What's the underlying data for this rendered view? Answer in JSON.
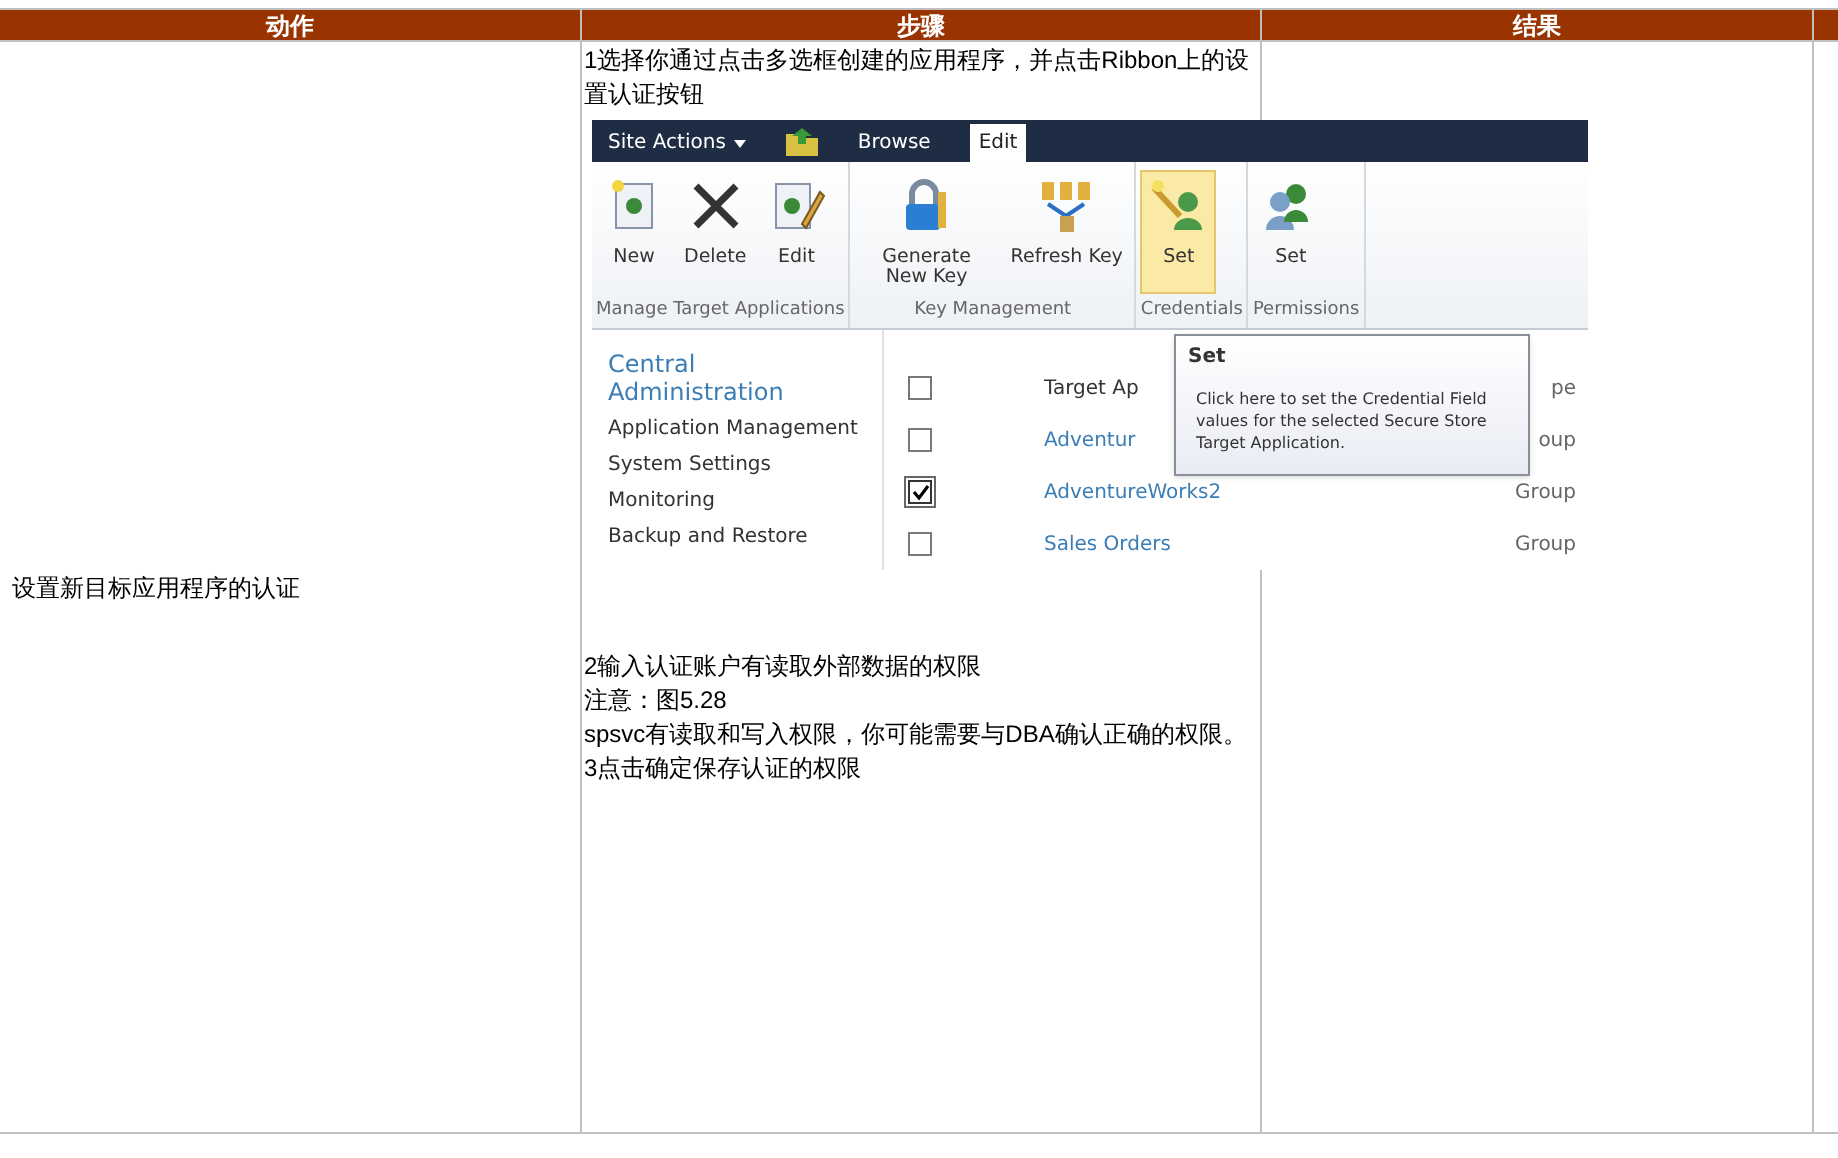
{
  "table": {
    "columns": [
      "动作",
      "步骤",
      "结果"
    ],
    "rows": [
      {
        "action": "设置新目标应用程序的认证",
        "steps_before": [
          "1选择你通过点击多选框创建的应用程序，并点击Ribbon上的设置认证按钮"
        ],
        "screenshot": {
          "tabs": [
            {
              "label": "Site Actions",
              "kind": "menu",
              "selected": false
            },
            {
              "label": "Browse",
              "kind": "tab",
              "selected": false
            },
            {
              "label": "Edit",
              "kind": "tab",
              "selected": true
            }
          ],
          "groups": [
            {
              "label": "Manage Target Applications",
              "buttons": [
                {
                  "label": "New",
                  "kind": "new",
                  "highlighted": false
                },
                {
                  "label": "Delete",
                  "kind": "delete",
                  "highlighted": false
                },
                {
                  "label": "Edit",
                  "kind": "edit",
                  "highlighted": false
                }
              ]
            },
            {
              "label": "Key Management",
              "buttons": [
                {
                  "label": "Generate New Key",
                  "kind": "lock",
                  "highlighted": false
                },
                {
                  "label": "Refresh Key",
                  "kind": "refresh",
                  "highlighted": false
                }
              ]
            },
            {
              "label": "Credentials",
              "buttons": [
                {
                  "label": "Set",
                  "kind": "key",
                  "highlighted": true
                }
              ]
            },
            {
              "label": "Permissions",
              "buttons": [
                {
                  "label": "Set",
                  "kind": "people",
                  "highlighted": false
                }
              ]
            }
          ],
          "nav": [
            {
              "label": "Central Administration",
              "kind": "heading"
            },
            {
              "label": "Application Management",
              "kind": "link"
            },
            {
              "label": "System Settings",
              "kind": "link"
            },
            {
              "label": "Monitoring",
              "kind": "link"
            },
            {
              "label": "Backup and Restore",
              "kind": "link"
            }
          ],
          "list_header": {
            "checked": false,
            "name": "Target Ap",
            "type": "pe"
          },
          "list_rows": [
            {
              "checked": false,
              "name": "Adventur",
              "type": "oup"
            },
            {
              "checked": true,
              "name": "AdventureWorks2",
              "type": "Group"
            },
            {
              "checked": false,
              "name": "Sales Orders",
              "type": "Group"
            }
          ],
          "tooltip": {
            "title": "Set",
            "text": "Click here to set the Credential Field values for the selected Secure Store Target Application."
          }
        },
        "steps_after": [
          "2输入认证账户有读取外部数据的权限",
          "注意：图5.28",
          "spsvc有读取和写入权限，你可能需要与DBA确认正确的权限。",
          "3点击确定保存认证的权限"
        ],
        "result": ""
      }
    ]
  }
}
